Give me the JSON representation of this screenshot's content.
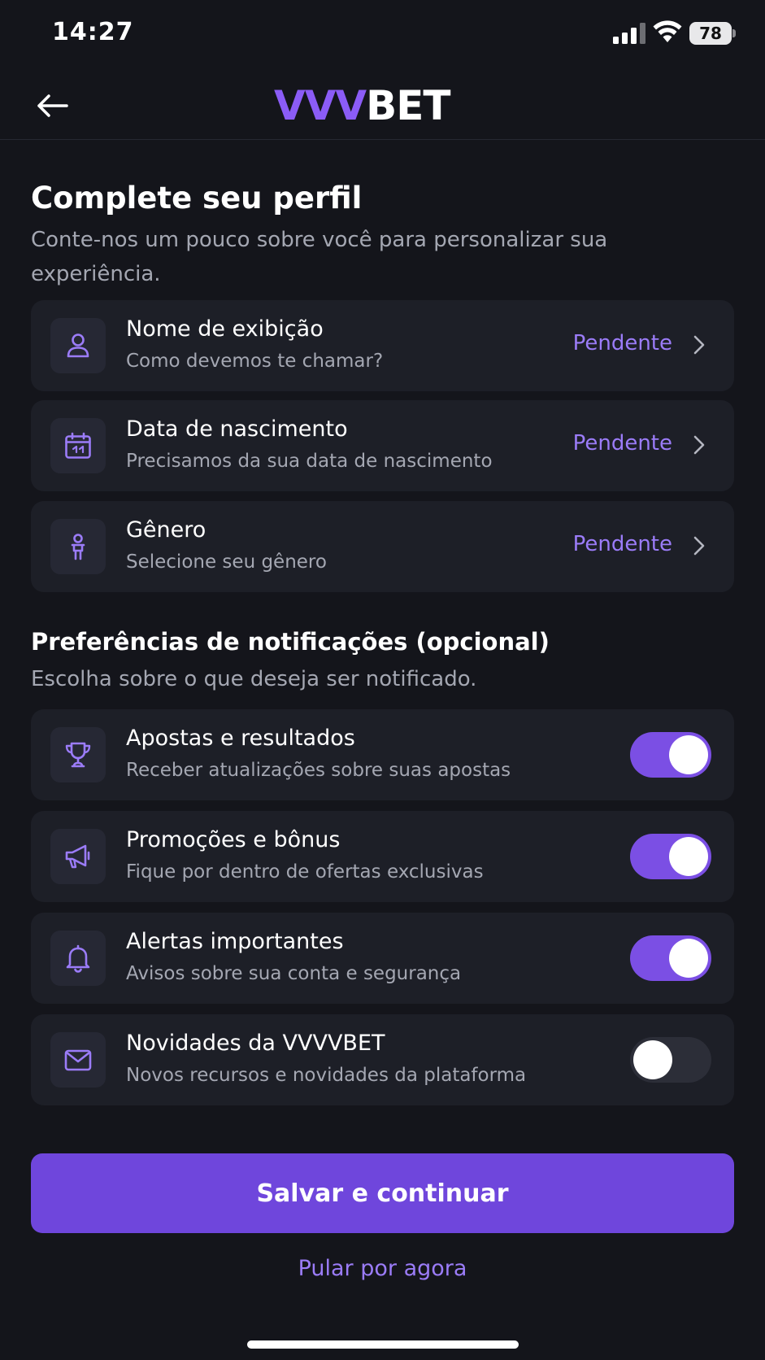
{
  "status_bar": {
    "time": "14:27",
    "battery": "78"
  },
  "header": {
    "logo_part1": "VVV",
    "logo_part2": "BET"
  },
  "profile": {
    "title": "Complete seu perfil",
    "subtitle": "Conte-nos um pouco sobre você para personalizar sua experiência.",
    "items": [
      {
        "title": "Nome de exibição",
        "description": "Como devemos te chamar?",
        "status": "Pendente",
        "icon": "user-icon"
      },
      {
        "title": "Data de nascimento",
        "description": "Precisamos da sua data de nascimento",
        "status": "Pendente",
        "icon": "calendar-icon"
      },
      {
        "title": "Gênero",
        "description": "Selecione seu gênero",
        "status": "Pendente",
        "icon": "person-icon"
      }
    ]
  },
  "notifications": {
    "title": "Preferências de notificações (opcional)",
    "subtitle": "Escolha sobre o que deseja ser notificado.",
    "items": [
      {
        "title": "Apostas e resultados",
        "description": "Receber atualizações sobre suas apostas",
        "enabled": true,
        "icon": "trophy-icon"
      },
      {
        "title": "Promoções e bônus",
        "description": "Fique por dentro de ofertas exclusivas",
        "enabled": true,
        "icon": "megaphone-icon"
      },
      {
        "title": "Alertas importantes",
        "description": "Avisos sobre sua conta e segurança",
        "enabled": true,
        "icon": "bell-icon"
      },
      {
        "title": "Novidades da VVVVBET",
        "description": "Novos recursos e novidades da plataforma",
        "enabled": false,
        "icon": "mail-icon"
      }
    ]
  },
  "actions": {
    "save_label": "Salvar e continuar",
    "skip_label": "Pular por agora"
  },
  "colors": {
    "accent": "#8b5cf6",
    "button": "#6f46dc",
    "background": "#14151b",
    "card": "#1d1f27"
  }
}
